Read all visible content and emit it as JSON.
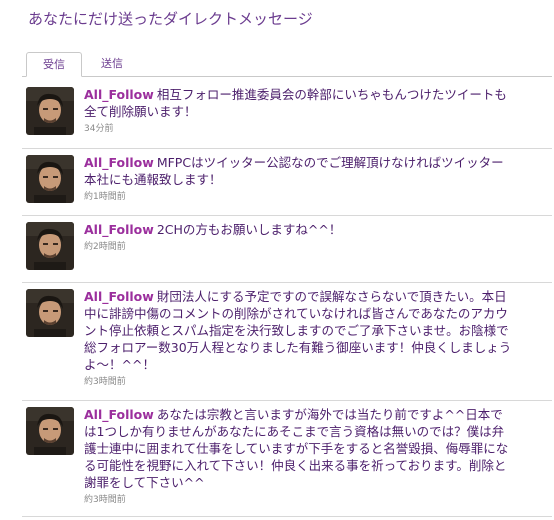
{
  "page": {
    "title": "あなたにだけ送ったダイレクトメッセージ"
  },
  "tabs": [
    {
      "label": "受信",
      "active": true
    },
    {
      "label": "送信",
      "active": false
    }
  ],
  "messages": [
    {
      "user": "All_Follow",
      "text": "相互フォロー推進委員会の幹部にいちゃもんつけたツイートも全て削除願います！",
      "time": "34分前"
    },
    {
      "user": "All_Follow",
      "text": "MFPCはツイッター公認なのでご理解頂けなければツイッター本社にも通報致します！",
      "time": "約1時間前"
    },
    {
      "user": "All_Follow",
      "text": "2CHの方もお願いしますね^^！",
      "time": "約2時間前"
    },
    {
      "user": "All_Follow",
      "text": "財団法人にする予定ですので誤解なさらないで頂きたい。本日中に誹謗中傷のコメントの削除がされていなければ皆さんであなたのアカウント停止依頼とスパム指定を決行致しますのでご了承下さいませ。お陰様で総フォロアー数30万人程となりました有難う御座います！仲良くしましょうよ〜！^^！",
      "time": "約3時間前"
    },
    {
      "user": "All_Follow",
      "text": "あなたは宗教と言いますが海外では当たり前ですよ^^日本では1つしか有りませんがあなたにあそこまで言う資格は無いのでは？僕は弁護士連中に囲まれて仕事をしていますが下手をすると名誉毀損、侮辱罪になる可能性を視野に入れて下さい！仲良く出来る事を祈っております。削除と謝罪をして下さい^^",
      "time": "約3時間前"
    }
  ],
  "colors": {
    "title": "#6b3c8f",
    "username": "#9b2f9d",
    "message_text": "#4b1e6b",
    "timestamp": "#8a8a8a",
    "divider": "#d8d8d8"
  }
}
